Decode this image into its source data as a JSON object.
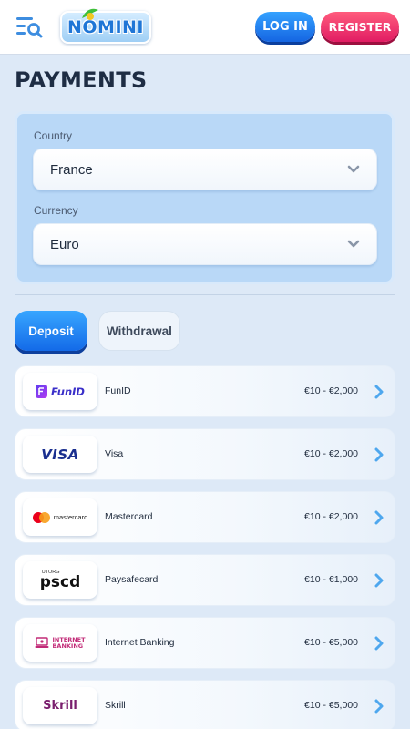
{
  "header": {
    "logo_text": "NOMINI",
    "login_label": "LOG IN",
    "register_label": "REGISTER"
  },
  "page": {
    "title": "PAYMENTS"
  },
  "filters": {
    "country_label": "Country",
    "country_value": "France",
    "currency_label": "Currency",
    "currency_value": "Euro"
  },
  "tabs": [
    {
      "label": "Deposit",
      "active": true
    },
    {
      "label": "Withdrawal",
      "active": false
    }
  ],
  "methods": [
    {
      "name": "FunID",
      "range": "€10 - €2,000",
      "logo": "FunID"
    },
    {
      "name": "Visa",
      "range": "€10 - €2,000",
      "logo": "VISA"
    },
    {
      "name": "Mastercard",
      "range": "€10 - €2,000",
      "logo": "mastercard"
    },
    {
      "name": "Paysafecard",
      "range": "€10 - €1,000",
      "logo": "pscd",
      "logo_small": "UTORG"
    },
    {
      "name": "Internet Banking",
      "range": "€10 - €5,000",
      "logo_line1": "INTERNET",
      "logo_line2": "BANKING"
    },
    {
      "name": "Skrill",
      "range": "€10 - €5,000",
      "logo": "Skrill"
    }
  ],
  "colors": {
    "accent_blue": "#1565e2",
    "accent_pink": "#e11c63",
    "background": "#dde9f7",
    "panel": "#b9d8f7"
  },
  "icons": {
    "menu": "menu-search-icon",
    "dropdown": "chevron-down-icon",
    "row": "chevron-right-icon"
  }
}
